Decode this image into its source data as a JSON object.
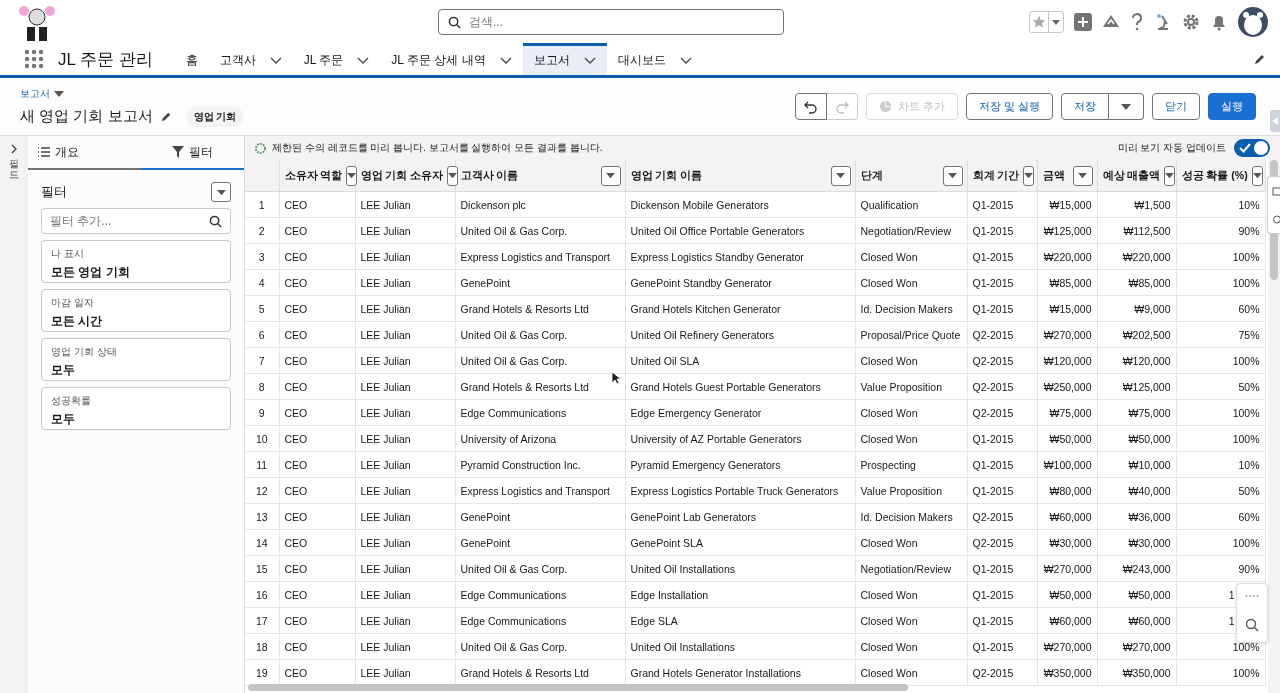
{
  "header": {
    "search": {
      "placeholder": "검색..."
    }
  },
  "nav": {
    "app_name": "JL 주문 관리",
    "items": [
      {
        "label": "홈",
        "has_menu": false,
        "selected": false
      },
      {
        "label": "고객사",
        "has_menu": true,
        "selected": false
      },
      {
        "label": "JL 주문",
        "has_menu": true,
        "selected": false
      },
      {
        "label": "JL 주문 상세 내역",
        "has_menu": true,
        "selected": false
      },
      {
        "label": "보고서",
        "has_menu": true,
        "selected": true
      },
      {
        "label": "대시보드",
        "has_menu": true,
        "selected": false
      }
    ]
  },
  "page": {
    "breadcrumb": "보고서",
    "title": "새 영업 기회 보고서",
    "badge": "영업 기회",
    "actions": [
      {
        "kind": "undo",
        "disabled": false
      },
      {
        "kind": "redo",
        "disabled": true
      },
      {
        "kind": "button",
        "label": "차트 추가",
        "disabled": true
      },
      {
        "kind": "button",
        "label": "저장 및 실행",
        "disabled": false
      },
      {
        "kind": "split",
        "label": "저장",
        "disabled": false
      },
      {
        "kind": "button",
        "label": "닫기",
        "disabled": false
      },
      {
        "kind": "brand",
        "label": "실행",
        "disabled": false
      }
    ]
  },
  "rail": {
    "label": "필드"
  },
  "sidebar": {
    "tabs": [
      {
        "label": "개요",
        "selected": false
      },
      {
        "label": "필터",
        "selected": true
      }
    ],
    "heading": "필터",
    "filter_search": {
      "placeholder": "필터 추가..."
    },
    "filters": [
      {
        "label": "나 표시",
        "value": "모든 영업 기회"
      },
      {
        "label": "마감 일자",
        "value": "모든 시간"
      },
      {
        "label": "영업 기회 상태",
        "value": "모두"
      },
      {
        "label": "성공확률",
        "value": "모두"
      }
    ]
  },
  "preview": {
    "notice": "제한된 수의 레코드를 미리 봅니다. 보고서를 실행하여 모든 결과를 봅니다.",
    "auto_update": {
      "label": "미리 보기 자동 업데이트",
      "on": true
    }
  },
  "table": {
    "columns": [
      {
        "label": "소유자 역할"
      },
      {
        "label": "영업 기회 소유자"
      },
      {
        "label": "고객사 이름"
      },
      {
        "label": "영업 기회 이름"
      },
      {
        "label": "단계"
      },
      {
        "label": "회계 기간"
      },
      {
        "label": "금액"
      },
      {
        "label": "예상 매출액"
      },
      {
        "label": "성공 확률 (%)"
      }
    ],
    "rows": [
      {
        "num": "1",
        "covered": false,
        "cells": [
          "CEO",
          "LEE Julian",
          "Dickenson plc",
          "Dickenson Mobile Generators",
          "Qualification",
          "Q1-2015",
          "₩15,000",
          "₩1,500",
          "10%"
        ]
      },
      {
        "num": "2",
        "covered": false,
        "cells": [
          "CEO",
          "LEE Julian",
          "United Oil & Gas Corp.",
          "United Oil Office Portable Generators",
          "Negotiation/Review",
          "Q1-2015",
          "₩125,000",
          "₩112,500",
          "90%"
        ]
      },
      {
        "num": "3",
        "covered": false,
        "cells": [
          "CEO",
          "LEE Julian",
          "Express Logistics and Transport",
          "Express Logistics Standby Generator",
          "Closed Won",
          "Q1-2015",
          "₩220,000",
          "₩220,000",
          "100%"
        ]
      },
      {
        "num": "4",
        "covered": false,
        "cells": [
          "CEO",
          "LEE Julian",
          "GenePoint",
          "GenePoint Standby Generator",
          "Closed Won",
          "Q1-2015",
          "₩85,000",
          "₩85,000",
          "100%"
        ]
      },
      {
        "num": "5",
        "covered": false,
        "cells": [
          "CEO",
          "LEE Julian",
          "Grand Hotels & Resorts Ltd",
          "Grand Hotels Kitchen Generator",
          "Id. Decision Makers",
          "Q1-2015",
          "₩15,000",
          "₩9,000",
          "60%"
        ]
      },
      {
        "num": "6",
        "covered": false,
        "cells": [
          "CEO",
          "LEE Julian",
          "United Oil & Gas Corp.",
          "United Oil Refinery Generators",
          "Proposal/Price Quote",
          "Q2-2015",
          "₩270,000",
          "₩202,500",
          "75%"
        ]
      },
      {
        "num": "7",
        "covered": false,
        "cells": [
          "CEO",
          "LEE Julian",
          "United Oil & Gas Corp.",
          "United Oil SLA",
          "Closed Won",
          "Q2-2015",
          "₩120,000",
          "₩120,000",
          "100%"
        ]
      },
      {
        "num": "8",
        "covered": false,
        "cells": [
          "CEO",
          "LEE Julian",
          "Grand Hotels & Resorts Ltd",
          "Grand Hotels Guest Portable Generators",
          "Value Proposition",
          "Q2-2015",
          "₩250,000",
          "₩125,000",
          "50%"
        ]
      },
      {
        "num": "9",
        "covered": false,
        "cells": [
          "CEO",
          "LEE Julian",
          "Edge Communications",
          "Edge Emergency Generator",
          "Closed Won",
          "Q2-2015",
          "₩75,000",
          "₩75,000",
          "100%"
        ]
      },
      {
        "num": "10",
        "covered": false,
        "cells": [
          "CEO",
          "LEE Julian",
          "University of Arizona",
          "University of AZ Portable Generators",
          "Closed Won",
          "Q1-2015",
          "₩50,000",
          "₩50,000",
          "100%"
        ]
      },
      {
        "num": "11",
        "covered": false,
        "cells": [
          "CEO",
          "LEE Julian",
          "Pyramid Construction Inc.",
          "Pyramid Emergency Generators",
          "Prospecting",
          "Q1-2015",
          "₩100,000",
          "₩10,000",
          "10%"
        ]
      },
      {
        "num": "12",
        "covered": false,
        "cells": [
          "CEO",
          "LEE Julian",
          "Express Logistics and Transport",
          "Express Logistics Portable Truck Generators",
          "Value Proposition",
          "Q1-2015",
          "₩80,000",
          "₩40,000",
          "50%"
        ]
      },
      {
        "num": "13",
        "covered": false,
        "cells": [
          "CEO",
          "LEE Julian",
          "GenePoint",
          "GenePoint Lab Generators",
          "Id. Decision Makers",
          "Q2-2015",
          "₩60,000",
          "₩36,000",
          "60%"
        ]
      },
      {
        "num": "14",
        "covered": false,
        "cells": [
          "CEO",
          "LEE Julian",
          "GenePoint",
          "GenePoint SLA",
          "Closed Won",
          "Q2-2015",
          "₩30,000",
          "₩30,000",
          "100%"
        ]
      },
      {
        "num": "15",
        "covered": false,
        "cells": [
          "CEO",
          "LEE Julian",
          "United Oil & Gas Corp.",
          "United Oil Installations",
          "Negotiation/Review",
          "Q1-2015",
          "₩270,000",
          "₩243,000",
          "90%"
        ]
      },
      {
        "num": "16",
        "covered": true,
        "cells": [
          "CEO",
          "LEE Julian",
          "Edge Communications",
          "Edge Installation",
          "Closed Won",
          "Q1-2015",
          "₩50,000",
          "₩50,000",
          "1"
        ]
      },
      {
        "num": "17",
        "covered": true,
        "cells": [
          "CEO",
          "LEE Julian",
          "Edge Communications",
          "Edge SLA",
          "Closed Won",
          "Q1-2015",
          "₩60,000",
          "₩60,000",
          "1"
        ]
      },
      {
        "num": "18",
        "covered": false,
        "cells": [
          "CEO",
          "LEE Julian",
          "United Oil & Gas Corp.",
          "United Oil Installations",
          "Closed Won",
          "Q1-2015",
          "₩270,000",
          "₩270,000",
          "100%"
        ]
      },
      {
        "num": "19",
        "covered": false,
        "cells": [
          "CEO",
          "LEE Julian",
          "Grand Hotels & Resorts Ltd",
          "Grand Hotels Generator Installations",
          "Closed Won",
          "Q2-2015",
          "₩350,000",
          "₩350,000",
          "100%"
        ]
      }
    ]
  }
}
